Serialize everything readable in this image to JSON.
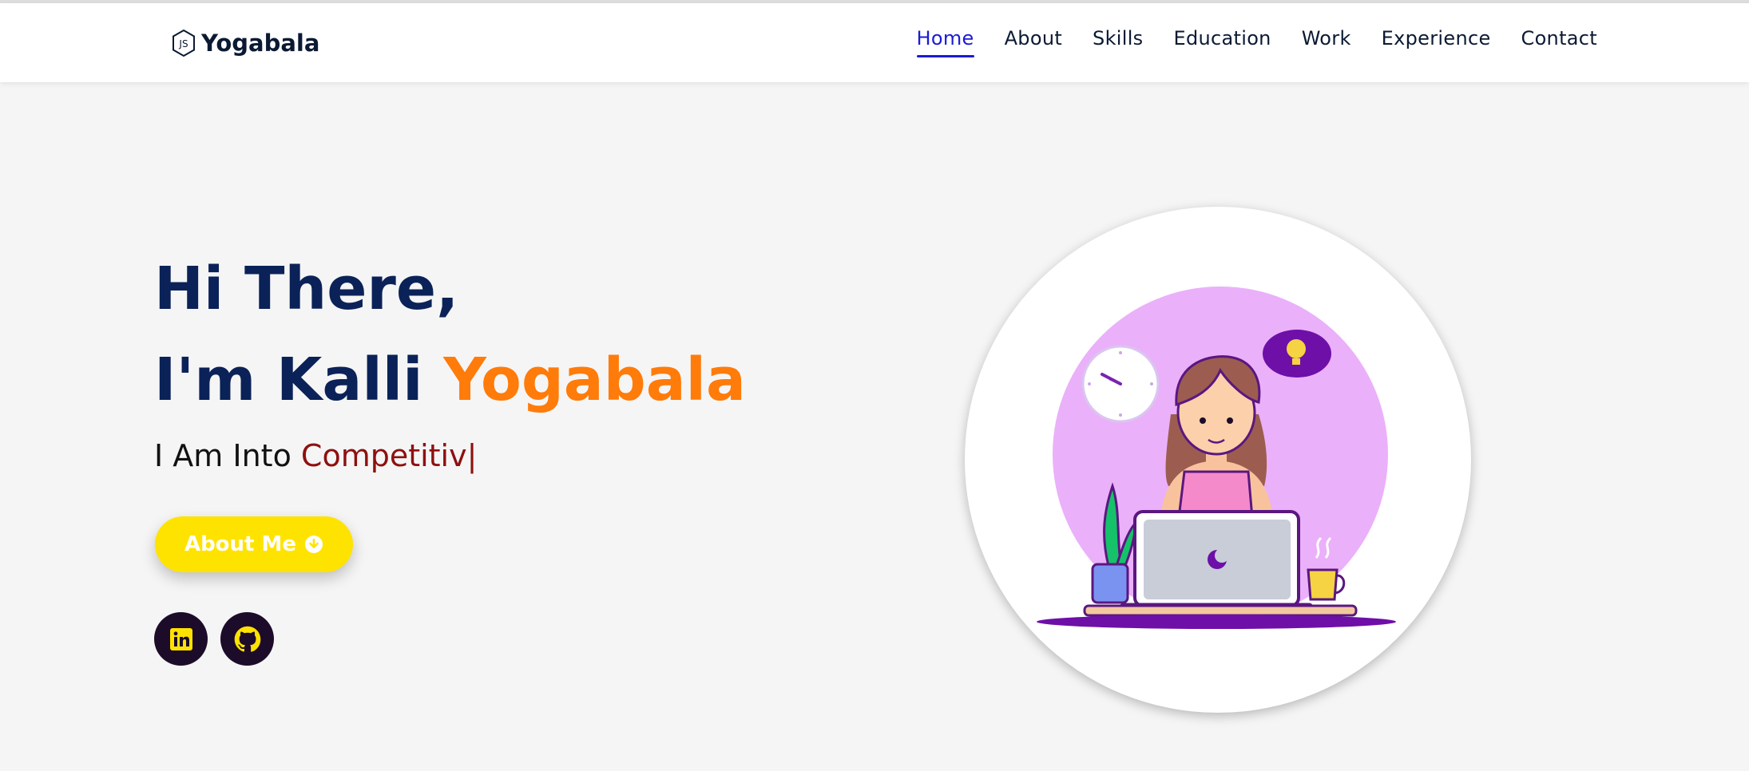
{
  "brand": {
    "name": "Yogabala",
    "logo_icon": "nodejs-hexagon-icon"
  },
  "nav": {
    "items": [
      {
        "label": "Home",
        "active": true
      },
      {
        "label": "About",
        "active": false
      },
      {
        "label": "Skills",
        "active": false
      },
      {
        "label": "Education",
        "active": false
      },
      {
        "label": "Work",
        "active": false
      },
      {
        "label": "Experience",
        "active": false
      },
      {
        "label": "Contact",
        "active": false
      }
    ],
    "active_color": "#1a1ad9"
  },
  "hero": {
    "greeting": "Hi There,",
    "intro_prefix": "I'm Kalli ",
    "intro_name": "Yogabala",
    "typed_prefix": "I Am Into ",
    "typed_word": "Competitiv",
    "cursor": "|",
    "button_label": "About Me",
    "button_icon": "arrow-down-circle-icon"
  },
  "social": [
    {
      "name": "linkedin",
      "icon": "linkedin-icon"
    },
    {
      "name": "github",
      "icon": "github-icon"
    }
  ],
  "colors": {
    "heading": "#0b2258",
    "name_accent": "#ff7b0a",
    "typed_accent": "#8e1010",
    "button": "#ffe300",
    "social_bg": "#1c0c2a",
    "social_icon": "#ffe300",
    "page_bg": "#f5f5f5"
  },
  "illustration": {
    "subject": "girl-working-on-laptop-illustration"
  }
}
